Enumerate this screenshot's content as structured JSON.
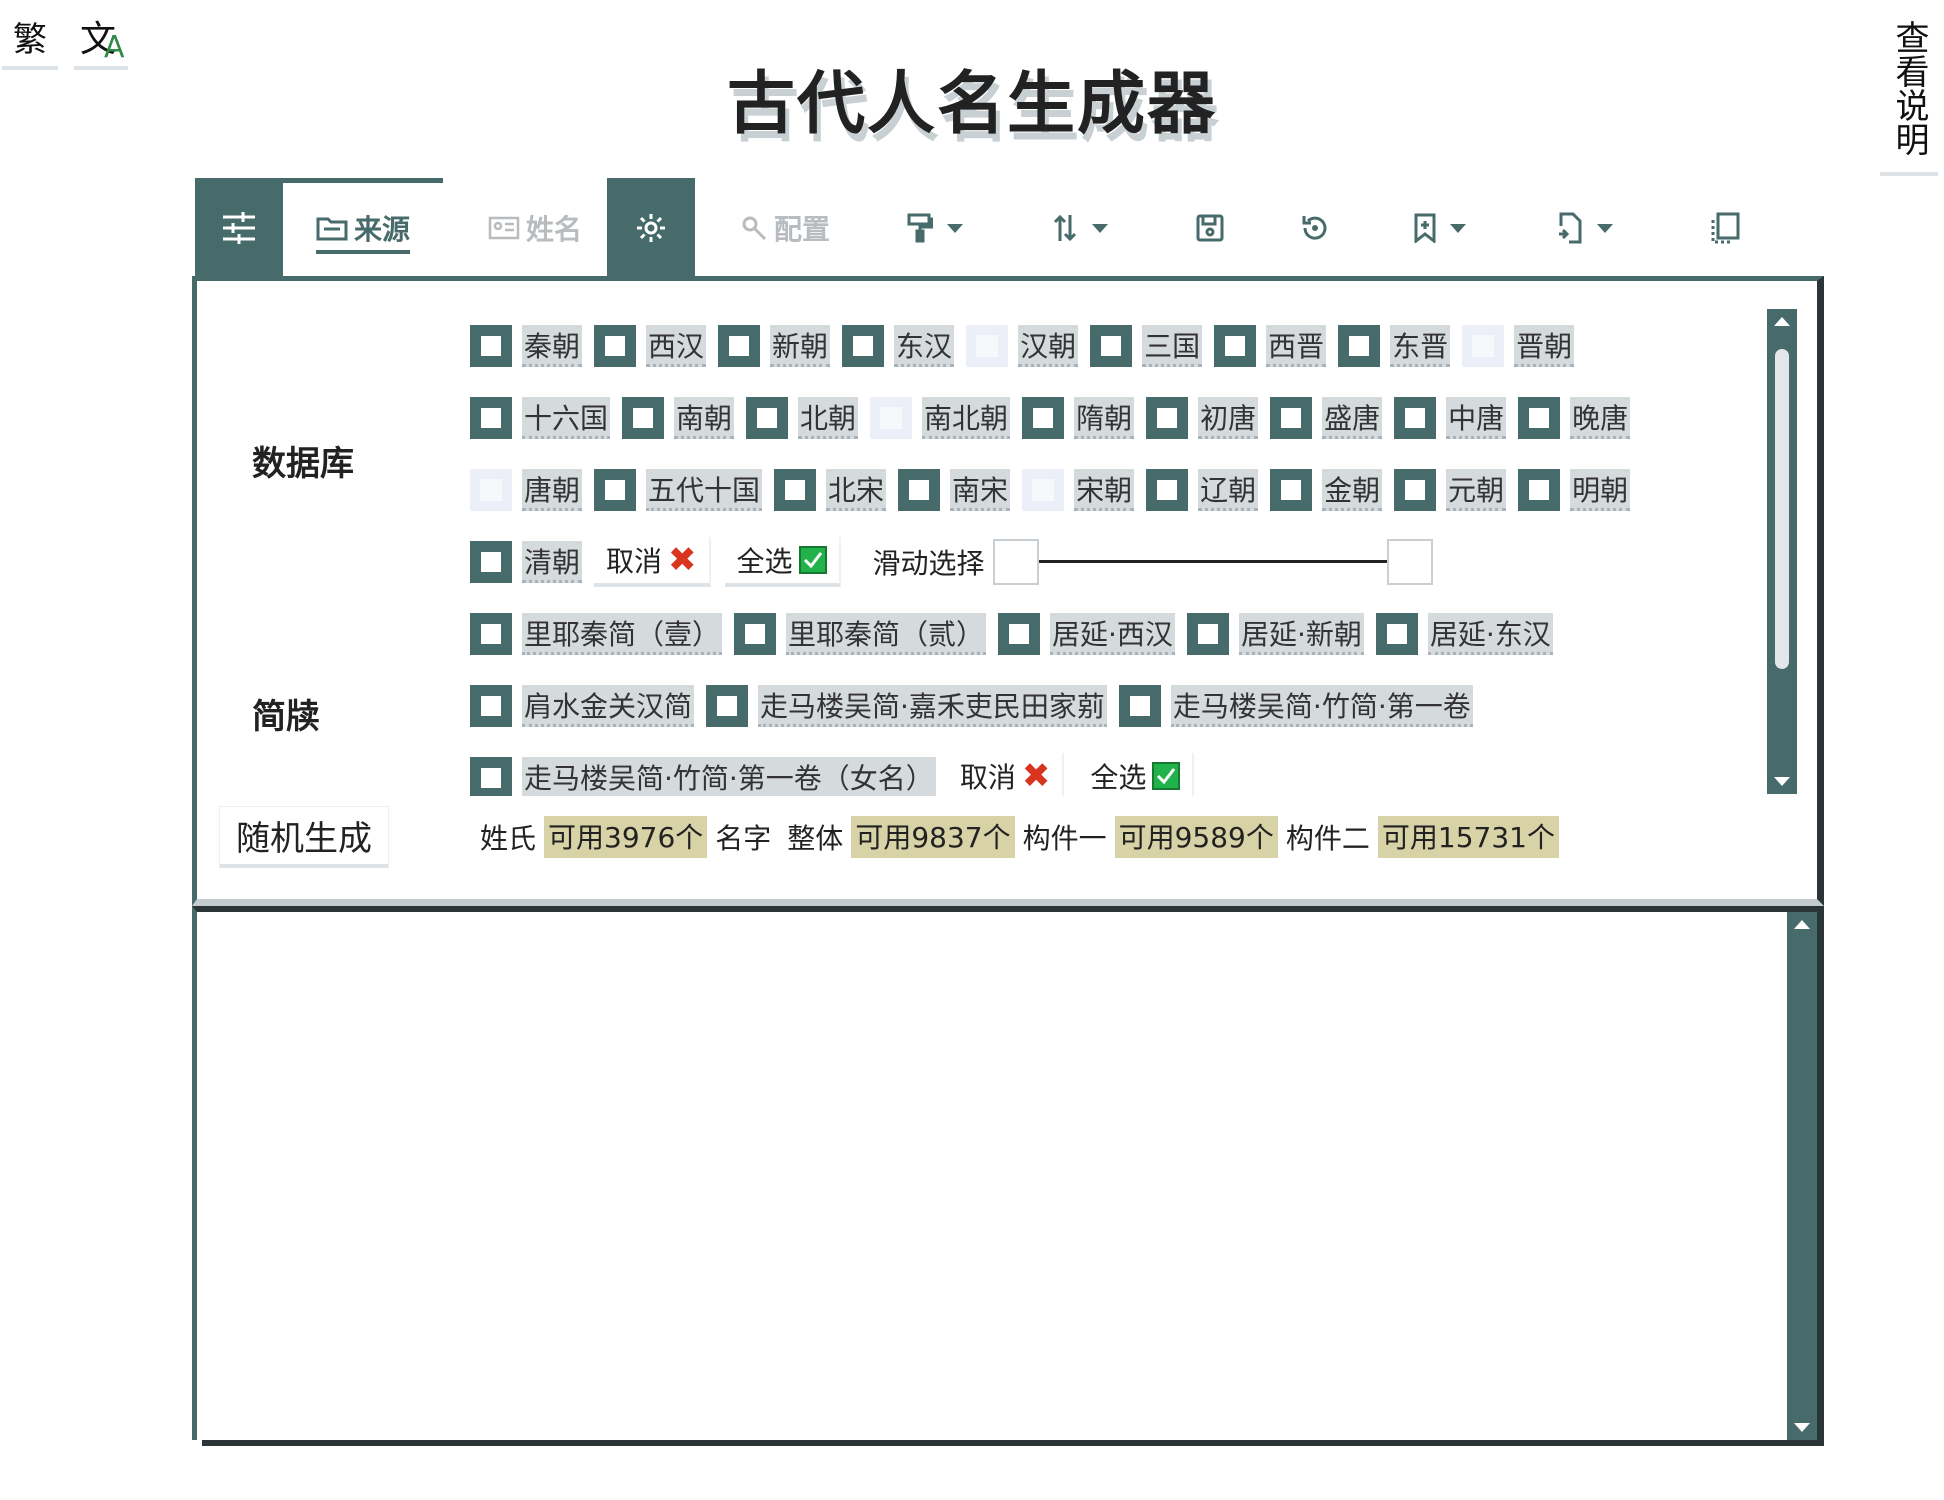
{
  "lang": {
    "traditional": "繁",
    "translate_glyph_a": "文",
    "translate_glyph_b": "A"
  },
  "help_button": "查看说明",
  "title": "古代人名生成器",
  "tabs": {
    "source": "来源",
    "name": "姓名",
    "config": "配置"
  },
  "toolbar_icons": [
    "sliders-icon",
    "folder-icon",
    "id-card-icon",
    "gear-icon",
    "wrench-icon",
    "paint-roller-icon",
    "sort-icon",
    "save-icon",
    "reset-icon",
    "bookmark-icon",
    "export-icon",
    "copy-icon"
  ],
  "sections": {
    "database": "数据库",
    "bamboo": "简牍"
  },
  "database_rows": [
    [
      {
        "label": "秦朝",
        "checked": true
      },
      {
        "label": "西汉",
        "checked": true
      },
      {
        "label": "新朝",
        "checked": true
      },
      {
        "label": "东汉",
        "checked": true
      },
      {
        "label": "汉朝",
        "checked": false
      },
      {
        "label": "三国",
        "checked": true
      },
      {
        "label": "西晋",
        "checked": true
      },
      {
        "label": "东晋",
        "checked": true
      },
      {
        "label": "晋朝",
        "checked": false
      }
    ],
    [
      {
        "label": "十六国",
        "checked": true
      },
      {
        "label": "南朝",
        "checked": true
      },
      {
        "label": "北朝",
        "checked": true
      },
      {
        "label": "南北朝",
        "checked": false
      },
      {
        "label": "隋朝",
        "checked": true
      },
      {
        "label": "初唐",
        "checked": true
      },
      {
        "label": "盛唐",
        "checked": true
      },
      {
        "label": "中唐",
        "checked": true
      },
      {
        "label": "晚唐",
        "checked": true
      }
    ],
    [
      {
        "label": "唐朝",
        "checked": false
      },
      {
        "label": "五代十国",
        "checked": true
      },
      {
        "label": "北宋",
        "checked": true
      },
      {
        "label": "南宋",
        "checked": true
      },
      {
        "label": "宋朝",
        "checked": false
      },
      {
        "label": "辽朝",
        "checked": true
      },
      {
        "label": "金朝",
        "checked": true
      },
      {
        "label": "元朝",
        "checked": true
      },
      {
        "label": "明朝",
        "checked": true
      }
    ]
  ],
  "database_last": {
    "label": "清朝",
    "checked": true
  },
  "cancel_label": "取消",
  "select_all_label": "全选",
  "slider_label": "滑动选择",
  "bamboo_rows": [
    [
      {
        "label": "里耶秦简（壹）",
        "checked": true
      },
      {
        "label": "里耶秦简（贰）",
        "checked": true
      },
      {
        "label": "居延·西汉",
        "checked": true
      },
      {
        "label": "居延·新朝",
        "checked": true
      },
      {
        "label": "居延·东汉",
        "checked": true
      }
    ],
    [
      {
        "label": "肩水金关汉简",
        "checked": true
      },
      {
        "label": "走马楼吴简·嘉禾吏民田家莂",
        "checked": true
      },
      {
        "label": "走马楼吴简·竹简·第一卷",
        "checked": true
      }
    ]
  ],
  "bamboo_last": {
    "label": "走马楼吴简·竹简·第一卷（女名）",
    "checked": true
  },
  "generate_button": "随机生成",
  "stats": {
    "surname_label": "姓氏",
    "surname_value": "可用3976个",
    "given_label": "名字",
    "whole_label": "整体",
    "whole_value": "可用9837个",
    "part1_label": "构件一",
    "part1_value": "可用9589个",
    "part2_label": "构件二",
    "part2_value": "可用15731个"
  },
  "colors": {
    "accent": "#476a6a",
    "label_bg": "#d5dadd",
    "stat_bg": "#d8d3a6",
    "check_green": "#22b24c",
    "cross_red": "#d9341e"
  }
}
